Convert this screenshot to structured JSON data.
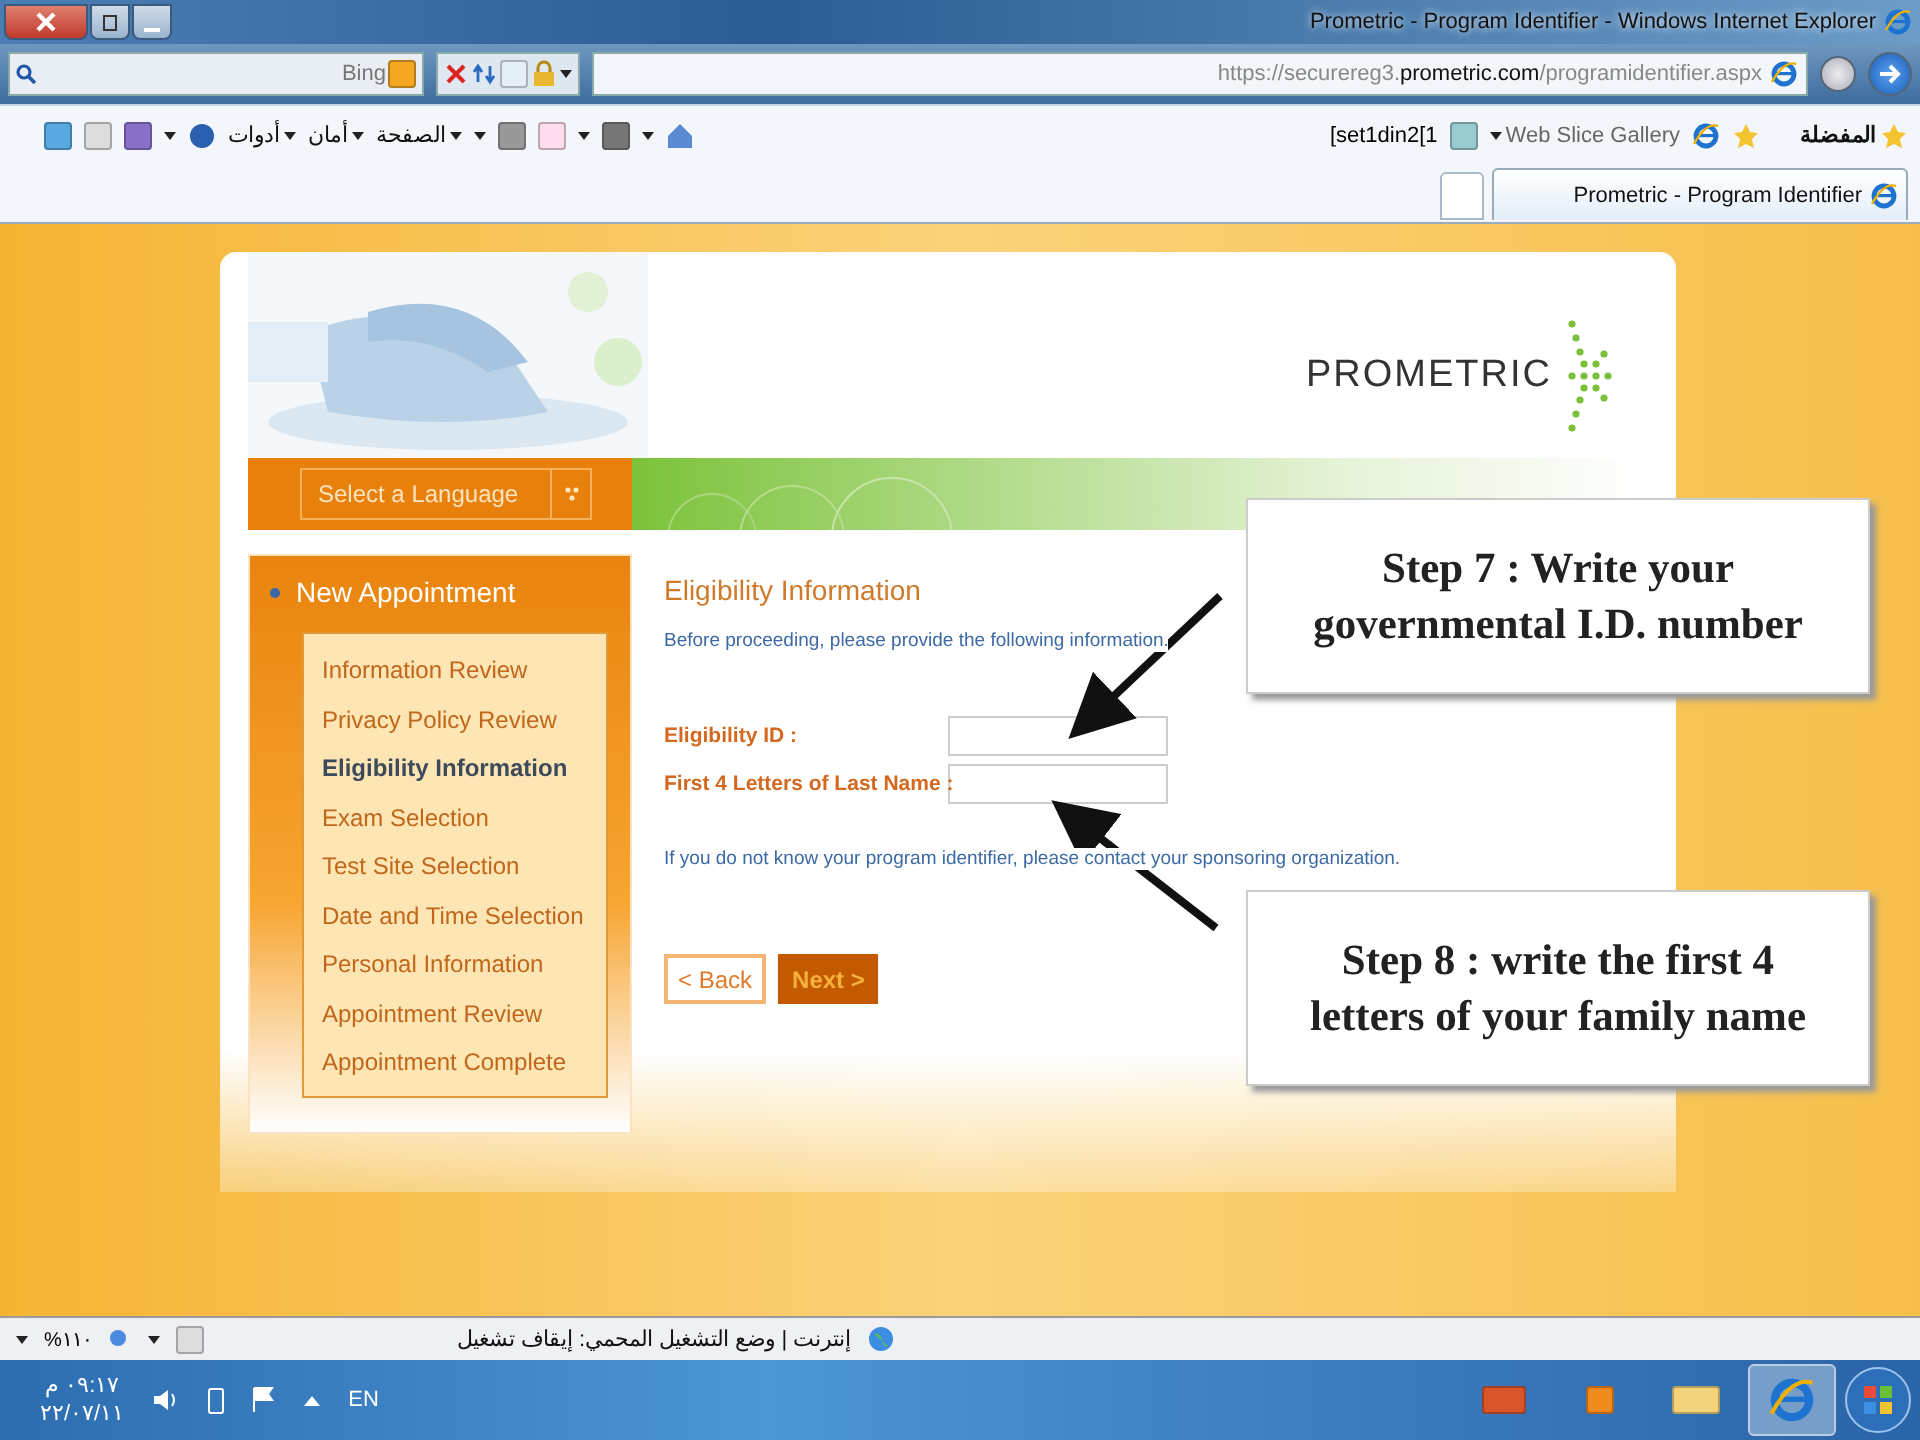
{
  "window": {
    "title": "Prometric - Program Identifier - Windows Internet Explorer"
  },
  "search": {
    "provider": "Bing"
  },
  "address": {
    "url": "https://securereg3.**prometric.com**/programidentifier.aspx"
  },
  "command_bar": {
    "menus": [
      "الصفحة",
      "أمان",
      "أدوات"
    ],
    "feed_item": "[set1din2[1",
    "web_slice": "Web Slice Gallery",
    "favorites": "المفضلة"
  },
  "tabs": [
    {
      "label": "Prometric - Program Identifier",
      "selected": true
    }
  ],
  "page": {
    "language_select": {
      "label": "Select a Language"
    },
    "logo": "PROMETRIC",
    "sidebar": {
      "title": "New Appointment",
      "items": [
        {
          "label": "Information Review",
          "selected": false
        },
        {
          "label": "Privacy Policy Review",
          "selected": false
        },
        {
          "label": "Eligibility Information",
          "selected": true
        },
        {
          "label": "Exam Selection",
          "selected": false
        },
        {
          "label": "Test Site Selection",
          "selected": false
        },
        {
          "label": "Date and Time Selection",
          "selected": false
        },
        {
          "label": "Personal Information",
          "selected": false
        },
        {
          "label": "Appointment Review",
          "selected": false
        },
        {
          "label": "Appointment Complete",
          "selected": false
        }
      ]
    },
    "form": {
      "title": "Eligibility Information",
      "intro": "Before proceeding, please provide the following information.",
      "fields": [
        {
          "label": "Eligibility ID :"
        },
        {
          "label": "First 4 Letters of Last Name :"
        }
      ],
      "help": "If you do not know your program identifier, please contact your sponsoring organization.",
      "buttons": [
        {
          "label": "< Back",
          "kind": "secondary"
        },
        {
          "label": "Next >",
          "kind": "primary"
        }
      ]
    }
  },
  "callouts": [
    {
      "text": "Step 7 : Write your governmental I.D. number"
    },
    {
      "text": "Step 8 : write the first 4 letters of your family name"
    }
  ],
  "status_bar": {
    "text": "إنترنت | وضع التشغيل المحمي: إيقاف تشغيل",
    "zoom": "%١١٠"
  },
  "taskbar": {
    "language": "EN",
    "time": "٠٩:١٧ م",
    "date": "٢٢/٠٧/١١"
  }
}
